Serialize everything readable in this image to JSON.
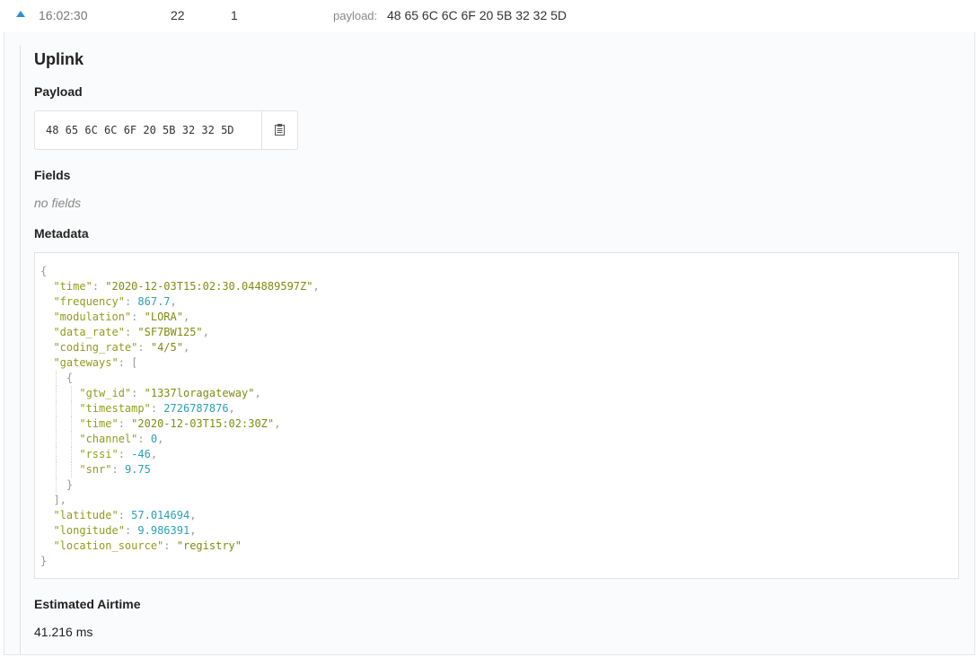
{
  "header": {
    "time": "16:02:30",
    "counter": "22",
    "port": "1",
    "payload_label": "payload:",
    "payload_value": "48 65 6C 6C 6F 20 5B 32 32 5D"
  },
  "uplink": {
    "title": "Uplink",
    "payload_heading": "Payload",
    "payload_hex": "48 65 6C 6C 6F 20 5B 32 32 5D",
    "fields_heading": "Fields",
    "fields_empty": "no fields",
    "metadata_heading": "Metadata",
    "airtime_heading": "Estimated Airtime",
    "airtime_value": "41.216 ms"
  },
  "metadata": {
    "time": "2020-12-03T15:02:30.044889597Z",
    "frequency": "867.7",
    "modulation": "LORA",
    "data_rate": "SF7BW125",
    "coding_rate": "4/5",
    "gateways": [
      {
        "gtw_id": "1337loragateway",
        "timestamp": "2726787876",
        "time": "2020-12-03T15:02:30Z",
        "channel": "0",
        "rssi": "-46",
        "snr": "9.75"
      }
    ],
    "latitude": "57.014694",
    "longitude": "9.986391",
    "location_source": "registry"
  },
  "icons": {
    "expand": "caret-up-icon",
    "copy": "clipboard-icon"
  },
  "colors": {
    "accent": "#2d8fd6",
    "json_key": "#8f9e1a",
    "json_string": "#7d8c12",
    "json_number": "#2aa1b3"
  }
}
